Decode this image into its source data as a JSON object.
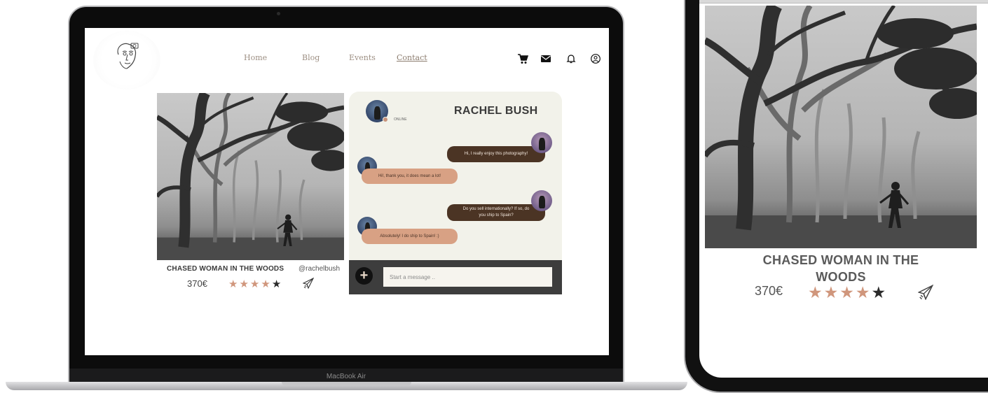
{
  "laptop": {
    "brand_label": "MacBook Air"
  },
  "nav": {
    "links": [
      "Home",
      "Blog",
      "Events",
      "Contact"
    ],
    "icons": [
      "cart-icon",
      "mail-icon",
      "bell-icon",
      "user-icon"
    ]
  },
  "product": {
    "title": "CHASED WOMAN IN THE WOODS",
    "handle": "@rachelbush",
    "price": "370€",
    "rating": 4,
    "rating_max": 5
  },
  "chat": {
    "name": "RACHEL BUSH",
    "status": "ONLINE",
    "messages": [
      {
        "from": "me",
        "text": "Hi, I really enjoy this photography!"
      },
      {
        "from": "them",
        "text": "Hi!, thank you, it does mean a lot!"
      },
      {
        "from": "me",
        "text": "Do you sell internationally? If so, do you ship to Spain?"
      },
      {
        "from": "them",
        "text": "Absolutely! I do ship to Spain! :)"
      }
    ],
    "input_placeholder": "Start a message ..",
    "plus_label": "+"
  },
  "phone": {
    "title": "CHASED WOMAN IN THE WOODS",
    "price": "370€"
  },
  "colors": {
    "accent_star": "#d0967c",
    "outgoing_bubble": "#4b3424",
    "incoming_bubble": "#d8a184",
    "chat_bg": "#f2f2ea"
  }
}
